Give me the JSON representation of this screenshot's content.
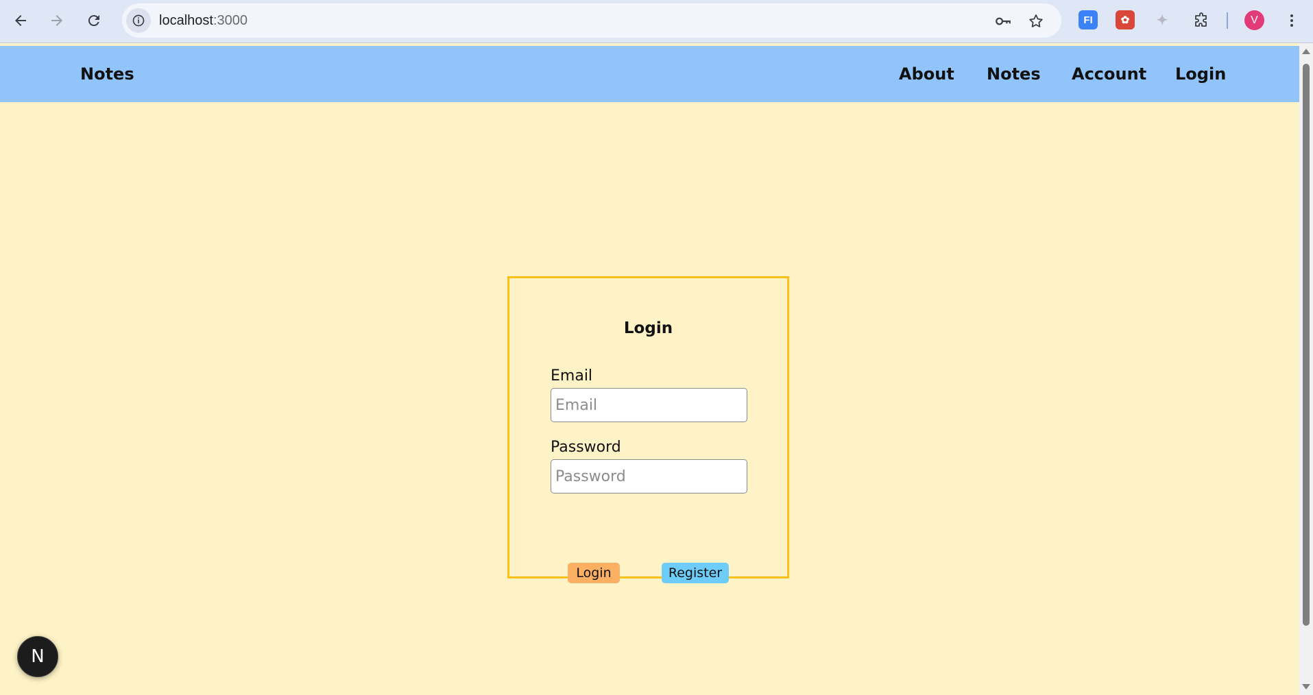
{
  "browser": {
    "url_host": "localhost",
    "url_port": ":3000",
    "avatar_letter": "V",
    "extensions": [
      {
        "name": "FI",
        "color": "#3b82f6"
      },
      {
        "name": "ext-red",
        "color": "#d9473a"
      },
      {
        "name": "ext-gray",
        "color": "#b8b8c8"
      }
    ]
  },
  "app": {
    "brand": "Notes",
    "nav": {
      "about": "About",
      "notes": "Notes",
      "account": "Account",
      "login": "Login"
    },
    "colors": {
      "page_bg": "#fef3c6",
      "nav_bg": "#90c4fb",
      "card_border": "#fdbe16",
      "login_button": "#fbb063",
      "register_button": "#6dcdf8"
    }
  },
  "login_form": {
    "title": "Login",
    "email_label": "Email",
    "email_placeholder": "Email",
    "email_value": "",
    "password_label": "Password",
    "password_placeholder": "Password",
    "password_value": "",
    "login_button": "Login",
    "register_button": "Register"
  },
  "dev_badge": {
    "letter": "N"
  }
}
